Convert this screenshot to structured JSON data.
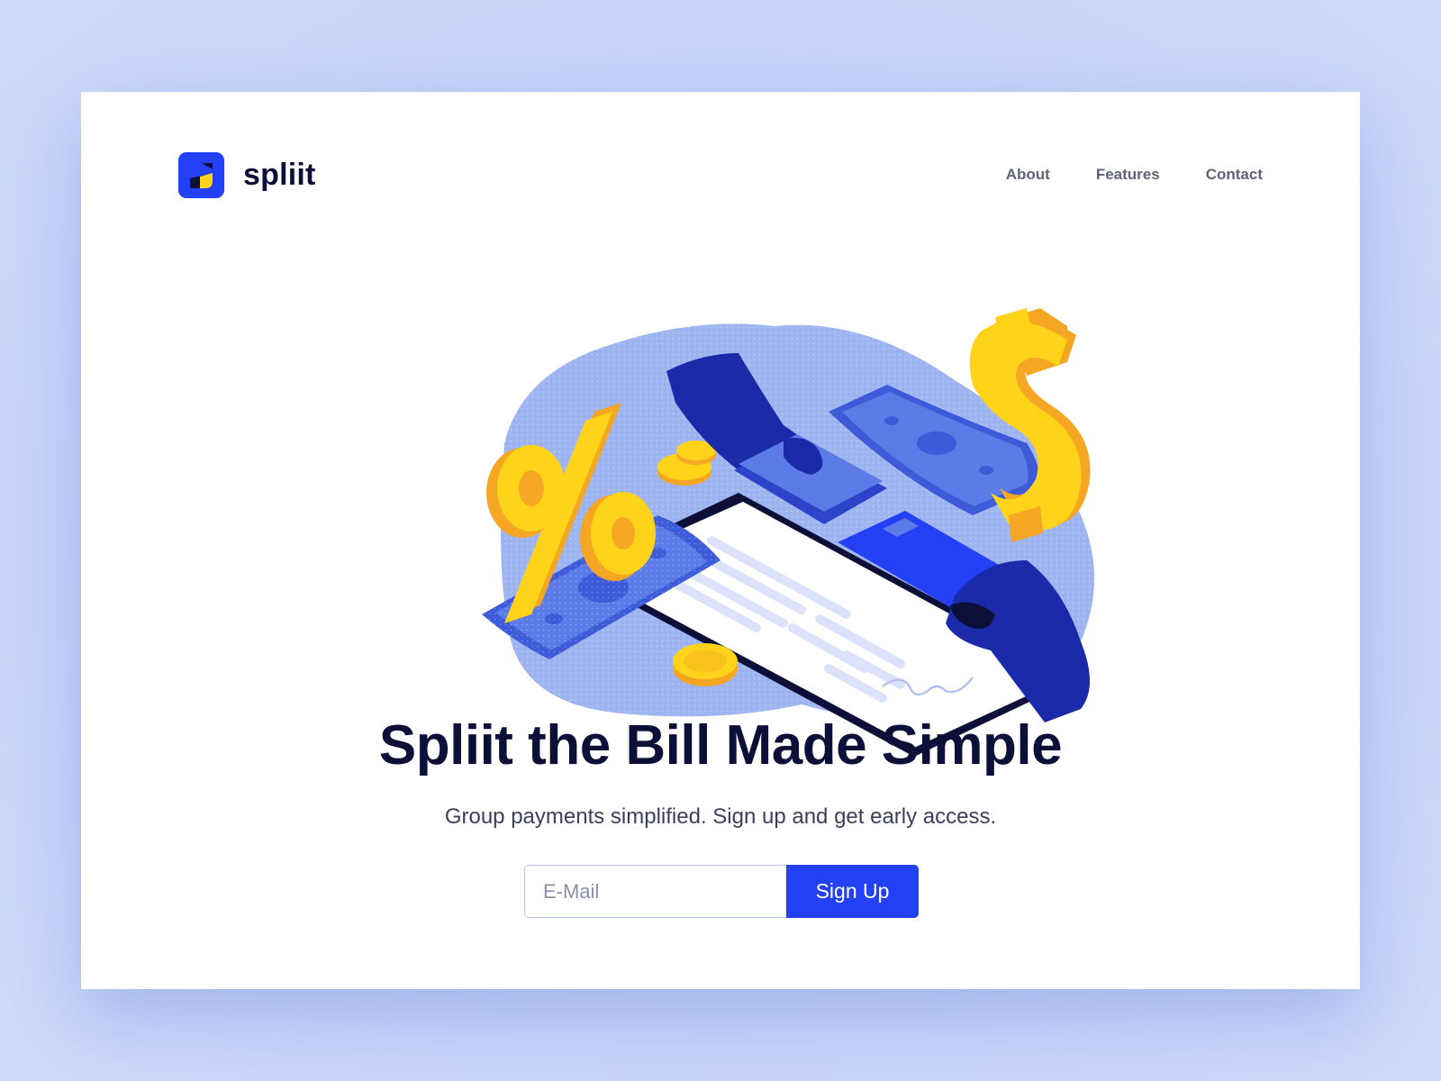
{
  "brand": {
    "name": "spliit",
    "logo_icon": "spliit-logo-icon",
    "primary_color": "#2340f5",
    "accent_color": "#ffd31a"
  },
  "nav": {
    "items": [
      {
        "label": "About"
      },
      {
        "label": "Features"
      },
      {
        "label": "Contact"
      }
    ]
  },
  "hero": {
    "illustration_icon": "bill-splitting-illustration",
    "headline": "Spliit the Bill Made Simple",
    "subheadline": "Group payments simplified. Sign up and get early access."
  },
  "signup_form": {
    "email_placeholder": "E-Mail",
    "email_value": "",
    "button_label": "Sign Up"
  }
}
